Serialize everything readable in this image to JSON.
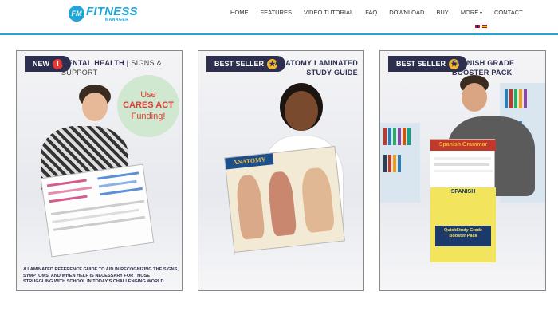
{
  "brand": {
    "logo_badge": "FM",
    "logo_main": "FITNESS",
    "logo_sub": "MANAGER",
    "accent_color": "#1ea6d8"
  },
  "nav": {
    "items": [
      "HOME",
      "FEATURES",
      "VIDEO TUTORIAL",
      "FAQ",
      "DOWNLOAD",
      "BUY",
      "MORE",
      "CONTACT"
    ]
  },
  "cards": [
    {
      "badge": "NEW",
      "badge_icon": "!",
      "title": "MENTAL HEALTH",
      "subtitle": "SIGNS & SUPPORT",
      "cares": [
        "Use",
        "CARES ACT",
        "Funding!"
      ],
      "caption": "A LAMINATED REFERENCE GUIDE TO AID IN RECOGNIZING THE SIGNS, SYMPTOMS, AND WHEN HELP IS NECESSARY FOR THOSE STRUGGLING WITH SCHOOL IN TODAY'S CHALLENGING WORLD."
    },
    {
      "badge": "BEST SELLER",
      "badge_icon": "★",
      "title": "ANATOMY LAMINATED STUDY GUIDE",
      "book_label": "ANATOMY"
    },
    {
      "badge": "BEST SELLER",
      "badge_icon": "★",
      "title": "SPANISH GRADE BOOSTER PACK",
      "book_label_1": "Spanish Grammar",
      "book_label_2": "SPANISH",
      "book_label_3": "QuickStudy Grade Booster Pack"
    }
  ]
}
